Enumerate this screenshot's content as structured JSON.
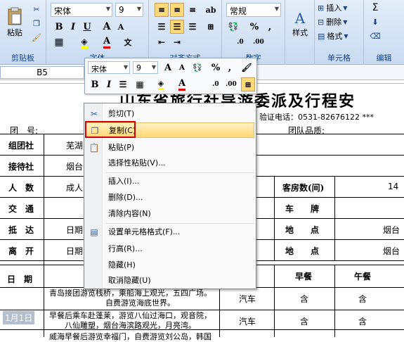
{
  "ribbon": {
    "paste_label": "粘贴",
    "clipboard_label": "剪贴板",
    "font_name": "宋体",
    "font_size": "9",
    "font_group_label": "字体",
    "align_group_label": "对齐方式",
    "number_format": "常规",
    "number_symbols": [
      "%",
      ","
    ],
    "number_group_label": "数字",
    "style_label": "样式",
    "insert_label": "插入",
    "delete_label": "删除",
    "format_label": "格式",
    "cells_group_label": "单元格",
    "sum_label": "Σ",
    "edit_group_label": "编辑"
  },
  "formula_bar": {
    "namebox": "B5"
  },
  "sheet": {
    "title": "山东省旅行社导游委派及行程安",
    "verify_phone": "* 验证电话：0531-82676122 ***",
    "team_no_label": "团　号:",
    "team_quality_label": "团队品质:",
    "rows": {
      "organizer_label": "组团社",
      "organizer_value": "芜湖",
      "receiver_label": "接待社",
      "receiver_value": "烟台",
      "people_label": "人　数",
      "people_value": "成人",
      "rooms_label": "客房数(间)",
      "rooms_value": "14",
      "traffic_label": "交　通",
      "car_label": "车　　牌",
      "arrive_label": "抵　达",
      "arrive_date": "日期",
      "place_label_1": "地　　点",
      "place_value_1": "烟台",
      "leave_label": "离　开",
      "leave_date": "日期",
      "place_label_2": "地　　点",
      "place_value_2": "烟台",
      "date_label": "日　期",
      "breakfast_label": "早餐",
      "lunch_label": "午餐"
    },
    "itinerary": [
      {
        "line1": "青岛接团游览栈桥，乘船海上观光，五四广场。",
        "line2": "自费游览海底世界。",
        "transport": "汽车",
        "breakfast": "含",
        "lunch": "含"
      },
      {
        "line1": "早餐后乘车赴蓬莱，游览八仙过海口，观音院，",
        "line2": "八仙雕塑，烟台海滨路观光，月亮湾。",
        "transport": "汽车",
        "breakfast": "含",
        "lunch": "含"
      },
      {
        "line1": "威海早餐后游览幸福门，自费游览刘公岛，韩国",
        "line2": "",
        "transport": "",
        "breakfast": "",
        "lunch": ""
      }
    ],
    "watermark": "1月1日"
  },
  "mini_toolbar": {
    "font_name": "宋体",
    "font_size": "9",
    "symbols": [
      "A",
      "A",
      "%",
      ","
    ]
  },
  "context_menu": {
    "items": [
      {
        "label": "剪切(T)",
        "icon": "scissors-icon"
      },
      {
        "label": "复制(C)",
        "icon": "copy-icon"
      },
      {
        "label": "粘贴(P)",
        "icon": "paste-icon"
      },
      {
        "label": "选择性粘贴(V)...",
        "icon": ""
      },
      {
        "label": "插入(I)...",
        "icon": ""
      },
      {
        "label": "删除(D)...",
        "icon": ""
      },
      {
        "label": "清除内容(N)",
        "icon": ""
      },
      {
        "label": "设置单元格格式(F)...",
        "icon": "format-cells-icon"
      },
      {
        "label": "行高(R)...",
        "icon": ""
      },
      {
        "label": "隐藏(H)",
        "icon": ""
      },
      {
        "label": "取消隐藏(U)",
        "icon": ""
      }
    ]
  },
  "colors": {
    "highlight": "#ffd775",
    "red_box": "#d40000",
    "ribbon": "#c9dbf1"
  }
}
